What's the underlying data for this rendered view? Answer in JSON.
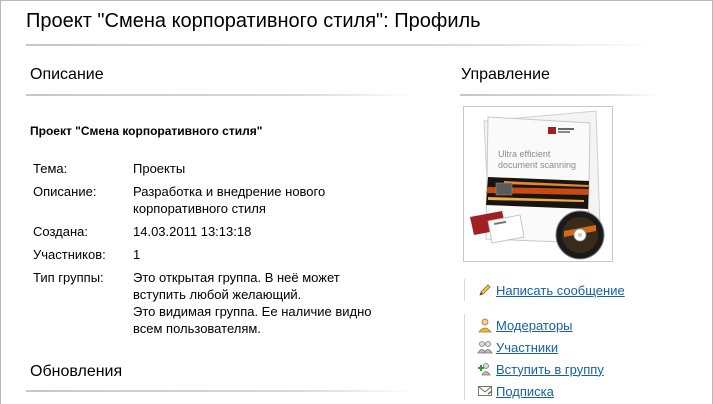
{
  "page": {
    "title": "Проект \"Смена корпоративного стиля\": Профиль"
  },
  "description": {
    "heading": "Описание",
    "group_name": "Проект \"Смена корпоративного стиля\"",
    "rows": [
      {
        "label": "Тема:",
        "value_lines": [
          "Проекты"
        ]
      },
      {
        "label": "Описание:",
        "value_lines": [
          "Разработка и внедрение нового",
          "корпоративного стиля"
        ]
      },
      {
        "label": "Создана:",
        "value_lines": [
          "14.03.2011 13:13:18"
        ]
      },
      {
        "label": "Участников:",
        "value_lines": [
          "1"
        ]
      },
      {
        "label": "Тип группы:",
        "value_lines": [
          "Это открытая группа. В неё может",
          "вступить любой желающий.",
          "Это видимая группа. Ее наличие видно",
          "всем пользователям."
        ]
      }
    ]
  },
  "updates": {
    "heading": "Обновления"
  },
  "management": {
    "heading": "Управление",
    "cover": {
      "headline_1": "Ultra efficient",
      "headline_2": "document scanning"
    },
    "actions": [
      {
        "label": "Написать сообщение",
        "icon": "pencil-icon"
      },
      {
        "label": "Модераторы",
        "icon": "moderator-icon"
      },
      {
        "label": "Участники",
        "icon": "members-icon"
      },
      {
        "label": "Вступить в группу",
        "icon": "join-group-icon"
      },
      {
        "label": "Подписка",
        "icon": "envelope-icon"
      }
    ]
  },
  "colors": {
    "link": "#1560a8",
    "rule": "#cccccc",
    "text": "#000000"
  }
}
